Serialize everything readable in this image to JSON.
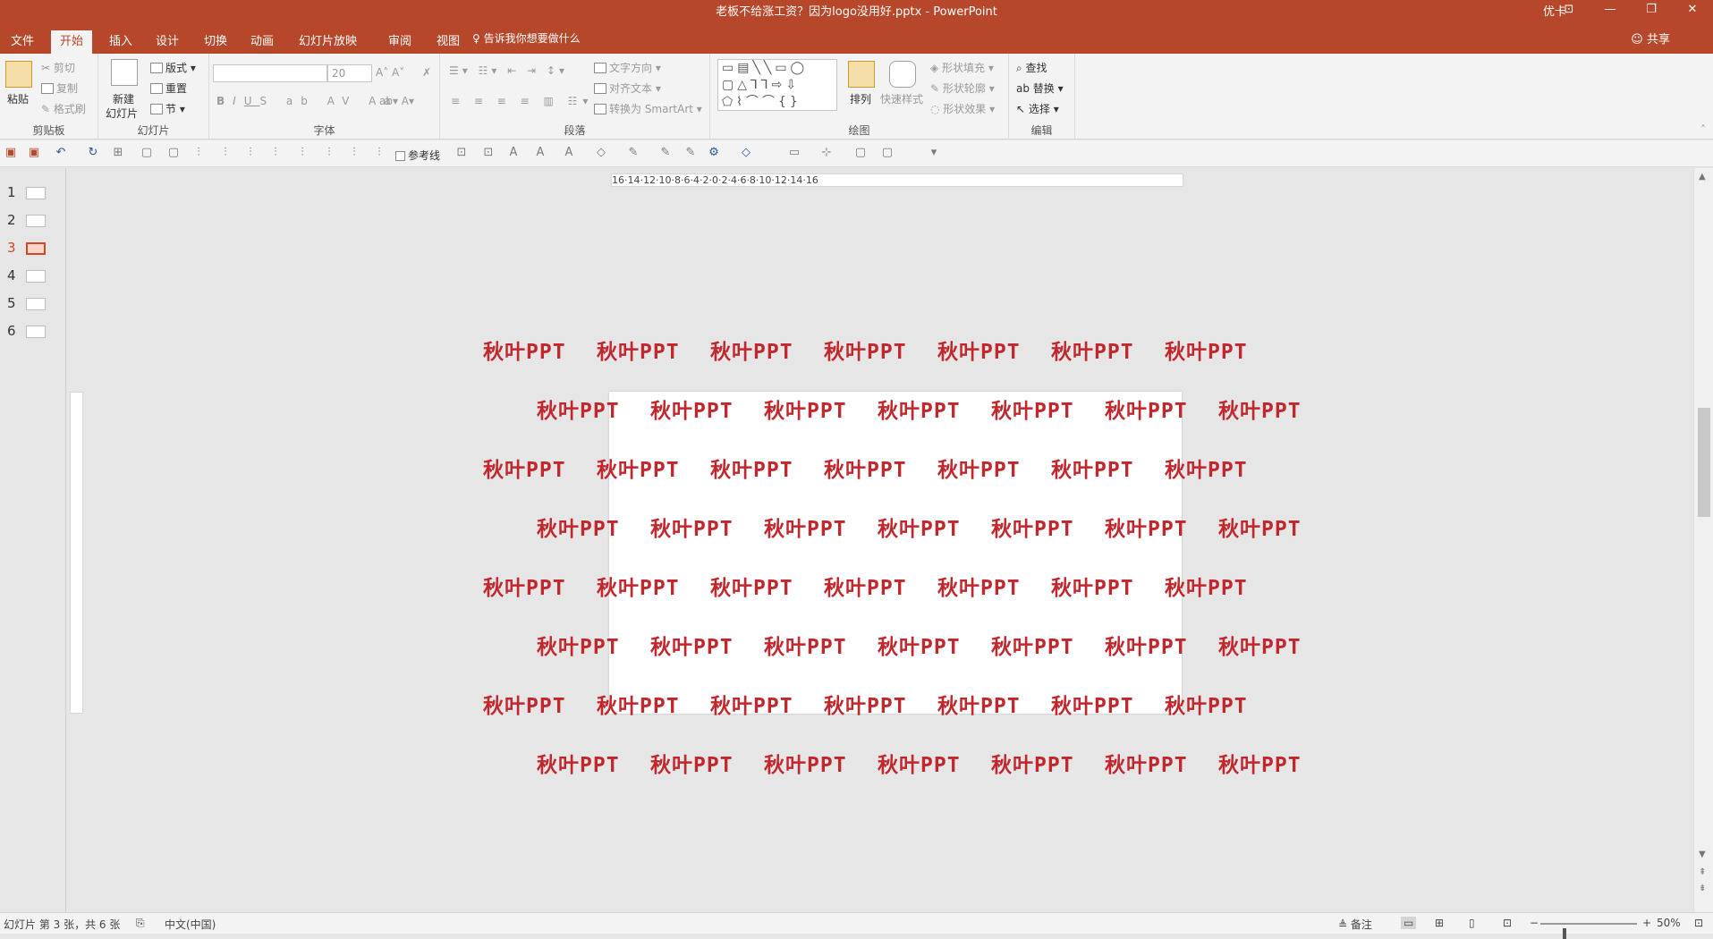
{
  "window": {
    "title": "老板不给涨工资？因为logo没用好.pptx  -  PowerPoint",
    "user": "优卡",
    "controls": [
      "⊡",
      "—",
      "❐",
      "✕"
    ]
  },
  "tabs": [
    {
      "label": "文件"
    },
    {
      "label": "开始",
      "active": true
    },
    {
      "label": "插入"
    },
    {
      "label": "设计"
    },
    {
      "label": "切换"
    },
    {
      "label": "动画"
    },
    {
      "label": "幻灯片放映"
    },
    {
      "label": "审阅"
    },
    {
      "label": "视图"
    }
  ],
  "tell_me": "告诉我你想要做什么",
  "share": "共享",
  "ribbon": {
    "clipboard": {
      "label": "剪贴板",
      "paste": "粘贴",
      "cut": "剪切",
      "copy": "复制",
      "format_painter": "格式刷"
    },
    "slides": {
      "label": "幻灯片",
      "new_slide_1": "新建",
      "new_slide_2": "幻灯片",
      "layout": "版式",
      "reset": "重置",
      "section": "节"
    },
    "font": {
      "label": "字体",
      "font_name": "",
      "font_size": "20"
    },
    "paragraph": {
      "label": "段落",
      "text_direction": "文字方向",
      "align_text": "对齐文本",
      "convert_smartart": "转换为 SmartArt"
    },
    "drawing": {
      "label": "绘图",
      "arrange": "排列",
      "quick_styles": "快速样式",
      "shape_fill": "形状填充",
      "shape_outline": "形状轮廓",
      "shape_effects": "形状效果"
    },
    "editing": {
      "label": "编辑",
      "find": "查找",
      "replace": "替换",
      "select": "选择"
    }
  },
  "qat": {
    "guides_label": "参考线"
  },
  "thumbnails": [
    {
      "num": "1"
    },
    {
      "num": "2"
    },
    {
      "num": "3",
      "active": true
    },
    {
      "num": "4"
    },
    {
      "num": "5"
    },
    {
      "num": "6"
    }
  ],
  "ruler": {
    "h_labels": "16·14·12·10·8·6·4·2·0·2·4·6·8·10·12·14·16"
  },
  "watermark": {
    "text": "秋叶PPT",
    "color": "#c1272d",
    "rows": 8,
    "per_row": 7
  },
  "status": {
    "slide_info": "幻灯片 第 3 张，共 6 张",
    "language": "中文(中国)",
    "notes": "备注",
    "zoom": "50%",
    "zoom_level": 0.5
  },
  "colors": {
    "accent": "#b7472a",
    "watermark": "#c1272d"
  }
}
